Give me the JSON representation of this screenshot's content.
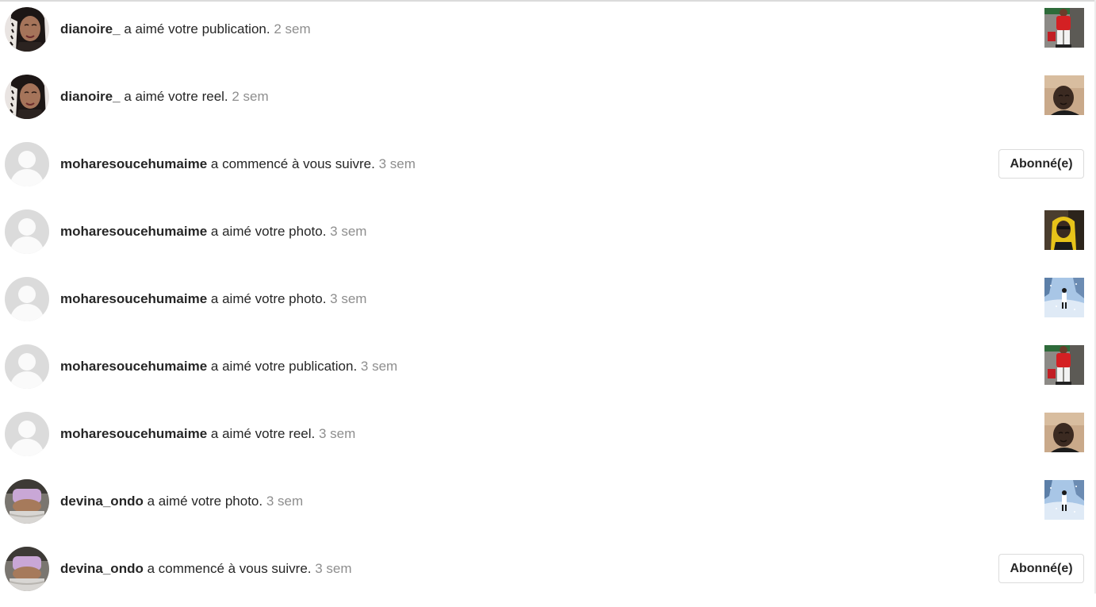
{
  "notifications": [
    {
      "user": "dianoire_",
      "action": " a aimé votre publication. ",
      "time": "2 sem",
      "avatar": "dianoire-avatar",
      "right": "thumb",
      "thumb": "red-jacket-photo"
    },
    {
      "user": "dianoire_",
      "action": " a aimé votre reel. ",
      "time": "2 sem",
      "avatar": "dianoire-avatar",
      "right": "thumb",
      "thumb": "face-selfie-photo"
    },
    {
      "user": "moharesoucehumaime",
      "action": " a commencé à vous suivre. ",
      "time": "3 sem",
      "avatar": "default-avatar",
      "right": "button",
      "button_label": "Abonné(e)"
    },
    {
      "user": "moharesoucehumaime",
      "action": " a aimé votre photo. ",
      "time": "3 sem",
      "avatar": "default-avatar",
      "right": "thumb",
      "thumb": "yellow-hood-photo"
    },
    {
      "user": "moharesoucehumaime",
      "action": " a aimé votre photo. ",
      "time": "3 sem",
      "avatar": "default-avatar",
      "right": "thumb",
      "thumb": "snow-scene-photo"
    },
    {
      "user": "moharesoucehumaime",
      "action": " a aimé votre publication. ",
      "time": "3 sem",
      "avatar": "default-avatar",
      "right": "thumb",
      "thumb": "red-jacket-photo"
    },
    {
      "user": "moharesoucehumaime",
      "action": " a aimé votre reel. ",
      "time": "3 sem",
      "avatar": "default-avatar",
      "right": "thumb",
      "thumb": "face-selfie-photo"
    },
    {
      "user": "devina_ondo",
      "action": " a aimé votre photo. ",
      "time": "3 sem",
      "avatar": "devina-avatar",
      "right": "thumb",
      "thumb": "snow-scene-photo"
    },
    {
      "user": "devina_ondo",
      "action": " a commencé à vous suivre. ",
      "time": "3 sem",
      "avatar": "devina-avatar",
      "right": "button",
      "button_label": "Abonné(e)"
    }
  ],
  "colors": {
    "text": "#262626",
    "muted": "#8e8e8e",
    "border": "#dbdbdb",
    "default_avatar_bg": "#dbdbdb"
  }
}
